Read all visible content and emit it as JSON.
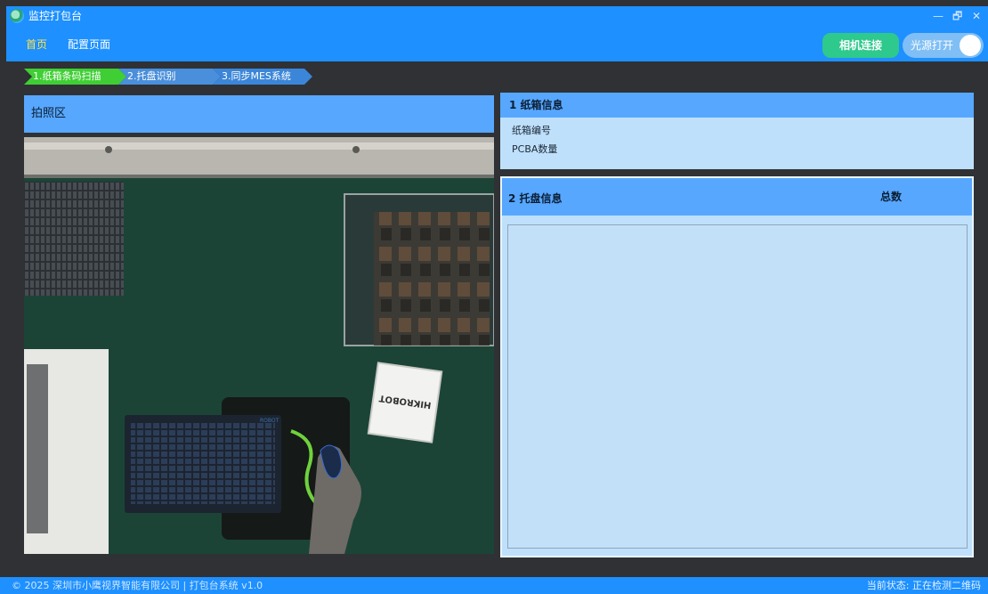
{
  "app": {
    "title": "监控打包台"
  },
  "window": {
    "minimize": "—",
    "restore": "🗗",
    "close": "✕"
  },
  "nav": {
    "home": "首页",
    "config": "配置页面"
  },
  "header_controls": {
    "camera_button": "相机连接",
    "light_toggle": "光源打开",
    "light_on": true
  },
  "steps": [
    {
      "label": "1.纸箱条码扫描",
      "active": true
    },
    {
      "label": "2.托盘识别",
      "active": false
    },
    {
      "label": "3.同步MES系统",
      "active": false
    }
  ],
  "capture": {
    "title": "拍照区",
    "keyboard_brand": "ROBOT",
    "box_label": "HIKROBOT"
  },
  "carton": {
    "title": "1 纸箱信息",
    "fields": [
      "纸箱编号",
      "PCBA数量"
    ]
  },
  "tray": {
    "title": "2 托盘信息",
    "total_label": "总数"
  },
  "footer": {
    "copyright": "© 2025 深圳市小鹰视界智能有限公司 | 打包台系统 v1.0",
    "status": "当前状态: 正在检测二维码"
  },
  "colors": {
    "accent": "#1e90ff",
    "panel_header": "#57a7ff",
    "panel_body": "#bfe0fb",
    "step_active": "#3fcf34",
    "camera_button": "#2ec98c"
  }
}
